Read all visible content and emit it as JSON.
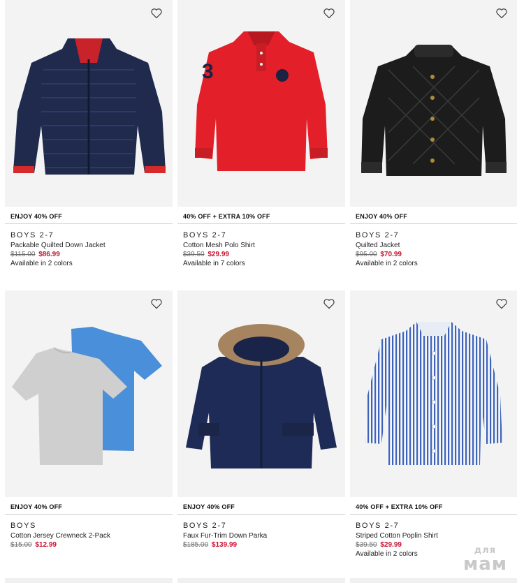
{
  "products": [
    {
      "promo": "ENJOY 40% OFF",
      "category": "BOYS 2-7",
      "name": "Packable Quilted Down Jacket",
      "original_price": "$115.00",
      "sale_price": "$86.99",
      "availability": "Available in 2 colors",
      "image": "navy-quilted-down-jacket"
    },
    {
      "promo": "40% OFF + EXTRA 10% OFF",
      "category": "BOYS 2-7",
      "name": "Cotton Mesh Polo Shirt",
      "original_price": "$39.50",
      "sale_price": "$29.99",
      "availability": "Available in 7 colors",
      "image": "red-polo-shirt"
    },
    {
      "promo": "ENJOY 40% OFF",
      "category": "BOYS 2-7",
      "name": "Quilted Jacket",
      "original_price": "$95.00",
      "sale_price": "$70.99",
      "availability": "Available in 2 colors",
      "image": "black-quilted-jacket"
    },
    {
      "promo": "ENJOY 40% OFF",
      "category": "BOYS",
      "name": "Cotton Jersey Crewneck 2-Pack",
      "original_price": "$15.00",
      "sale_price": "$12.99",
      "availability": "",
      "image": "grey-blue-tshirt-pack"
    },
    {
      "promo": "ENJOY 40% OFF",
      "category": "BOYS 2-7",
      "name": "Faux Fur-Trim Down Parka",
      "original_price": "$185.00",
      "sale_price": "$139.99",
      "availability": "",
      "image": "navy-fur-trim-parka"
    },
    {
      "promo": "40% OFF + EXTRA 10% OFF",
      "category": "BOYS 2-7",
      "name": "Striped Cotton Poplin Shirt",
      "original_price": "$39.50",
      "sale_price": "$29.99",
      "availability": "Available in 2 colors",
      "image": "blue-striped-shirt"
    }
  ],
  "icons": {
    "wishlist": "heart-outline-icon"
  },
  "colors": {
    "sale_price": "#c8102e",
    "image_bg": "#f3f3f3",
    "divider": "#cfcfcf"
  },
  "watermark": {
    "line1": "для",
    "line2": "мам"
  }
}
